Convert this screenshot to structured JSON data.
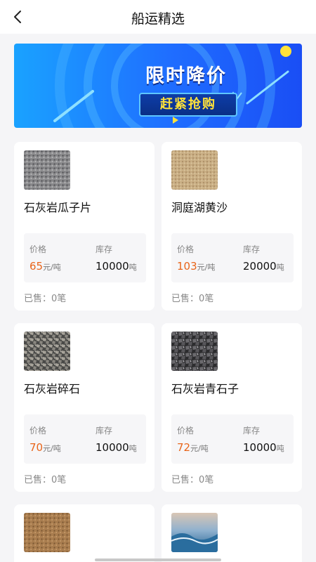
{
  "header": {
    "title": "船运精选"
  },
  "banner": {
    "title": "限时降价",
    "subtitle": "赶紧抢购"
  },
  "labels": {
    "price": "价格",
    "stock": "库存",
    "price_unit": "元/吨",
    "stock_unit": "吨"
  },
  "products": [
    {
      "name": "石灰岩瓜子片",
      "price": "65",
      "stock": "10000",
      "sold": "已售：0笔"
    },
    {
      "name": "洞庭湖黄沙",
      "price": "103",
      "stock": "20000",
      "sold": "已售：0笔"
    },
    {
      "name": "石灰岩碎石",
      "price": "70",
      "stock": "10000",
      "sold": "已售：0笔"
    },
    {
      "name": "石灰岩青石子",
      "price": "72",
      "stock": "10000",
      "sold": "已售：0笔"
    },
    {
      "name": "",
      "price": "",
      "stock": "",
      "sold": ""
    },
    {
      "name": "",
      "price": "",
      "stock": "",
      "sold": ""
    }
  ],
  "colors": {
    "accent_price": "#e8651a",
    "banner_blue": "#1f6dff",
    "banner_yellow": "#ffe23a"
  }
}
